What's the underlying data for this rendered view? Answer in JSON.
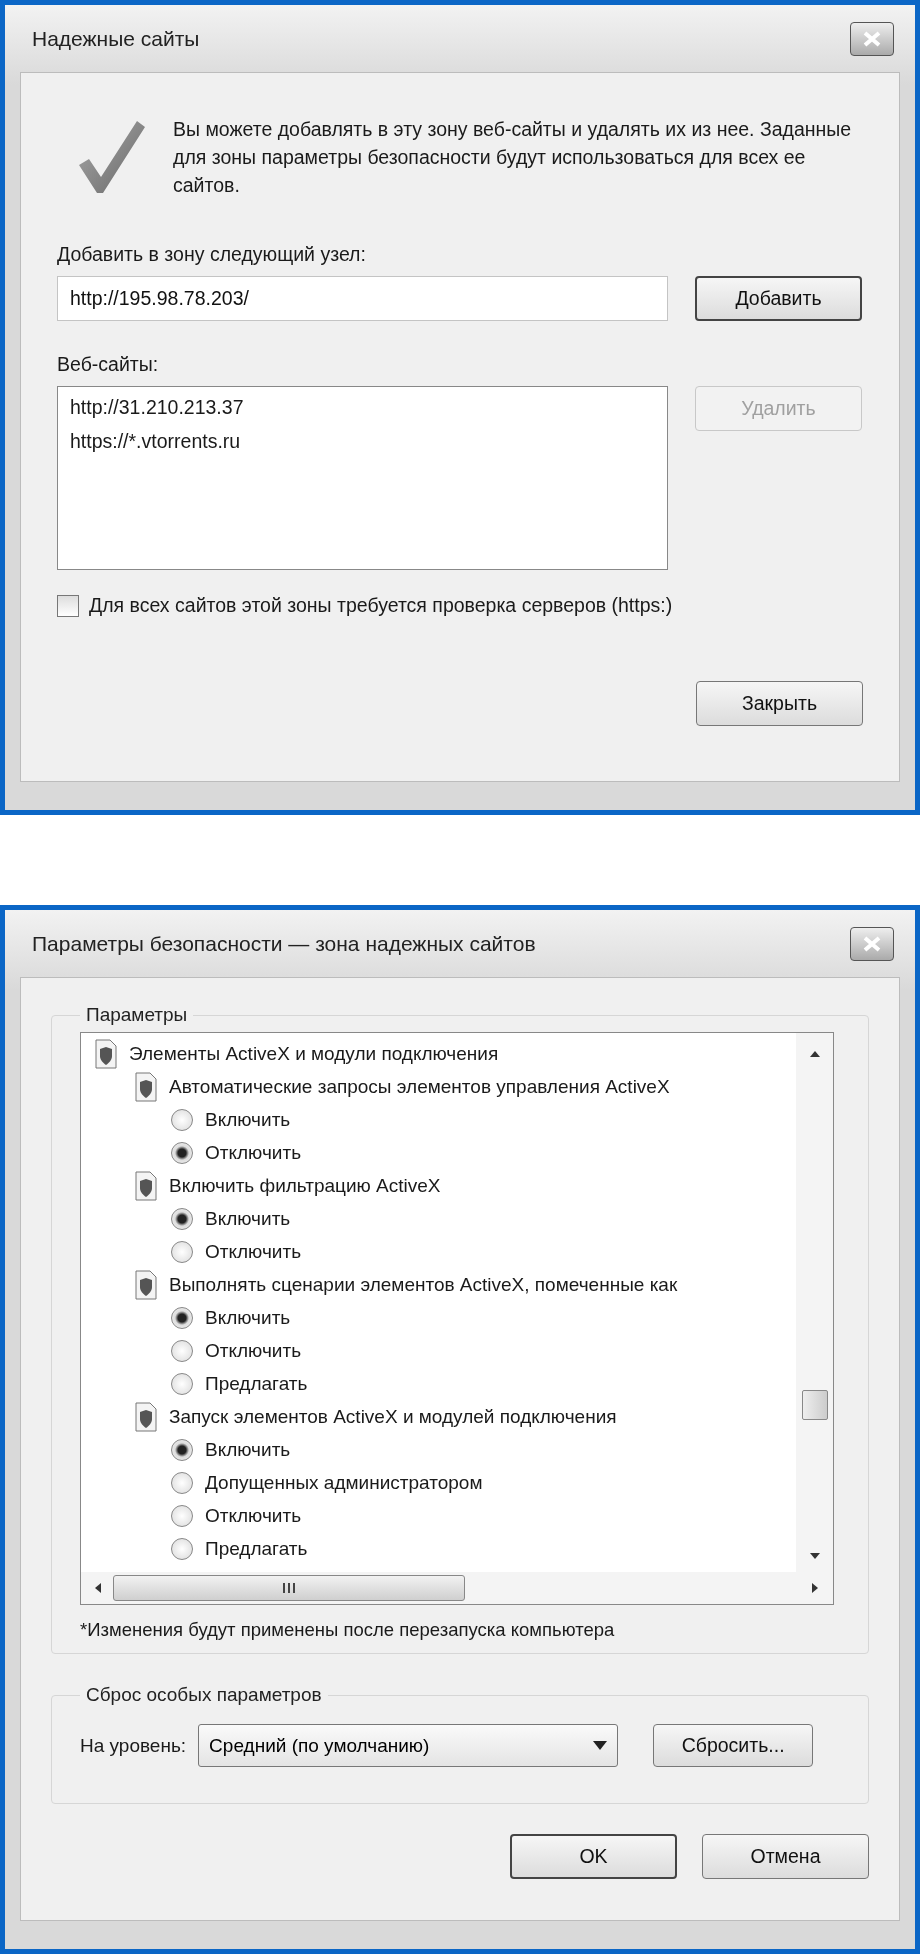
{
  "trusted_sites_dialog": {
    "title": "Надежные сайты",
    "intro": "Вы можете добавлять в эту зону  веб-сайты и удалять их из нее. Заданные для зоны параметры безопасности будут использоваться для всех ее сайтов.",
    "add_label": "Добавить в зону следующий узел:",
    "url_field": {
      "value": "http://195.98.78.203/"
    },
    "add_button": {
      "label": "Добавить",
      "default": true,
      "disabled": false
    },
    "sites_label": "Веб-сайты:",
    "sites": [
      "http://31.210.213.37",
      "https://*.vtorrents.ru"
    ],
    "remove_button": {
      "label": "Удалить",
      "default": false,
      "disabled": true
    },
    "https_checkbox": {
      "label": "Для всех сайтов этой зоны требуется проверка серверов (https:)",
      "checked": false
    },
    "close_button": {
      "label": "Закрыть",
      "default": false,
      "disabled": false
    }
  },
  "security_settings_dialog": {
    "title": "Параметры безопасности — зона надежных сайтов",
    "settings_group": {
      "title": "Параметры",
      "tree": [
        {
          "kind": "group",
          "label": "Элементы ActiveX и модули подключения",
          "children": [
            {
              "kind": "group",
              "label": "Автоматические запросы элементов управления ActiveX",
              "children": [
                {
                  "kind": "option",
                  "label": "Включить",
                  "selected": false
                },
                {
                  "kind": "option",
                  "label": "Отключить",
                  "selected": true
                }
              ]
            },
            {
              "kind": "group",
              "label": "Включить фильтрацию ActiveX",
              "children": [
                {
                  "kind": "option",
                  "label": "Включить",
                  "selected": true
                },
                {
                  "kind": "option",
                  "label": "Отключить",
                  "selected": false
                }
              ]
            },
            {
              "kind": "group",
              "label": "Выполнять сценарии элементов ActiveX, помеченные как",
              "children": [
                {
                  "kind": "option",
                  "label": "Включить",
                  "selected": true
                },
                {
                  "kind": "option",
                  "label": "Отключить",
                  "selected": false
                },
                {
                  "kind": "option",
                  "label": "Предлагать",
                  "selected": false
                }
              ]
            },
            {
              "kind": "group",
              "label": "Запуск элементов ActiveX и модулей подключения",
              "children": [
                {
                  "kind": "option",
                  "label": "Включить",
                  "selected": true
                },
                {
                  "kind": "option",
                  "label": "Допущенных администратором",
                  "selected": false
                },
                {
                  "kind": "option",
                  "label": "Отключить",
                  "selected": false
                },
                {
                  "kind": "option",
                  "label": "Предлагать",
                  "selected": false
                }
              ]
            }
          ]
        }
      ],
      "note": "*Изменения будут применены после перезапуска компьютера"
    },
    "reset_group": {
      "title": "Сброс особых параметров",
      "level_label": "На уровень:",
      "level_select": {
        "value": "Средний (по умолчанию)"
      },
      "reset_button": {
        "label": "Сбросить...",
        "default": false,
        "disabled": false
      }
    },
    "buttons": [
      {
        "label": "OK",
        "default": true,
        "disabled": false
      },
      {
        "label": "Отмена",
        "default": false,
        "disabled": false
      }
    ]
  }
}
